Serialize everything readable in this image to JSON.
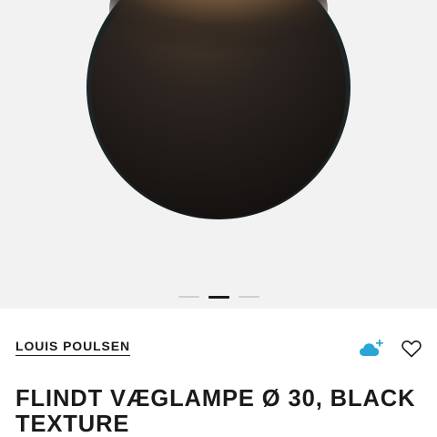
{
  "product": {
    "brand": "LOUIS POULSEN",
    "title": "FLINDT VÆGLAMPE Ø 30, BLACK TEXTURE"
  },
  "gallery": {
    "slide_count": 3,
    "active_slide": 2
  },
  "icons": {
    "cloud": "cloud-plus-icon",
    "favorite": "heart-icon"
  },
  "colors": {
    "gallery_background": "#f2f2f2",
    "accent": "#2aa6d6",
    "text": "#1a1a1a",
    "dot_inactive": "#cfcfcf",
    "dot_active": "#1b1b1b"
  }
}
